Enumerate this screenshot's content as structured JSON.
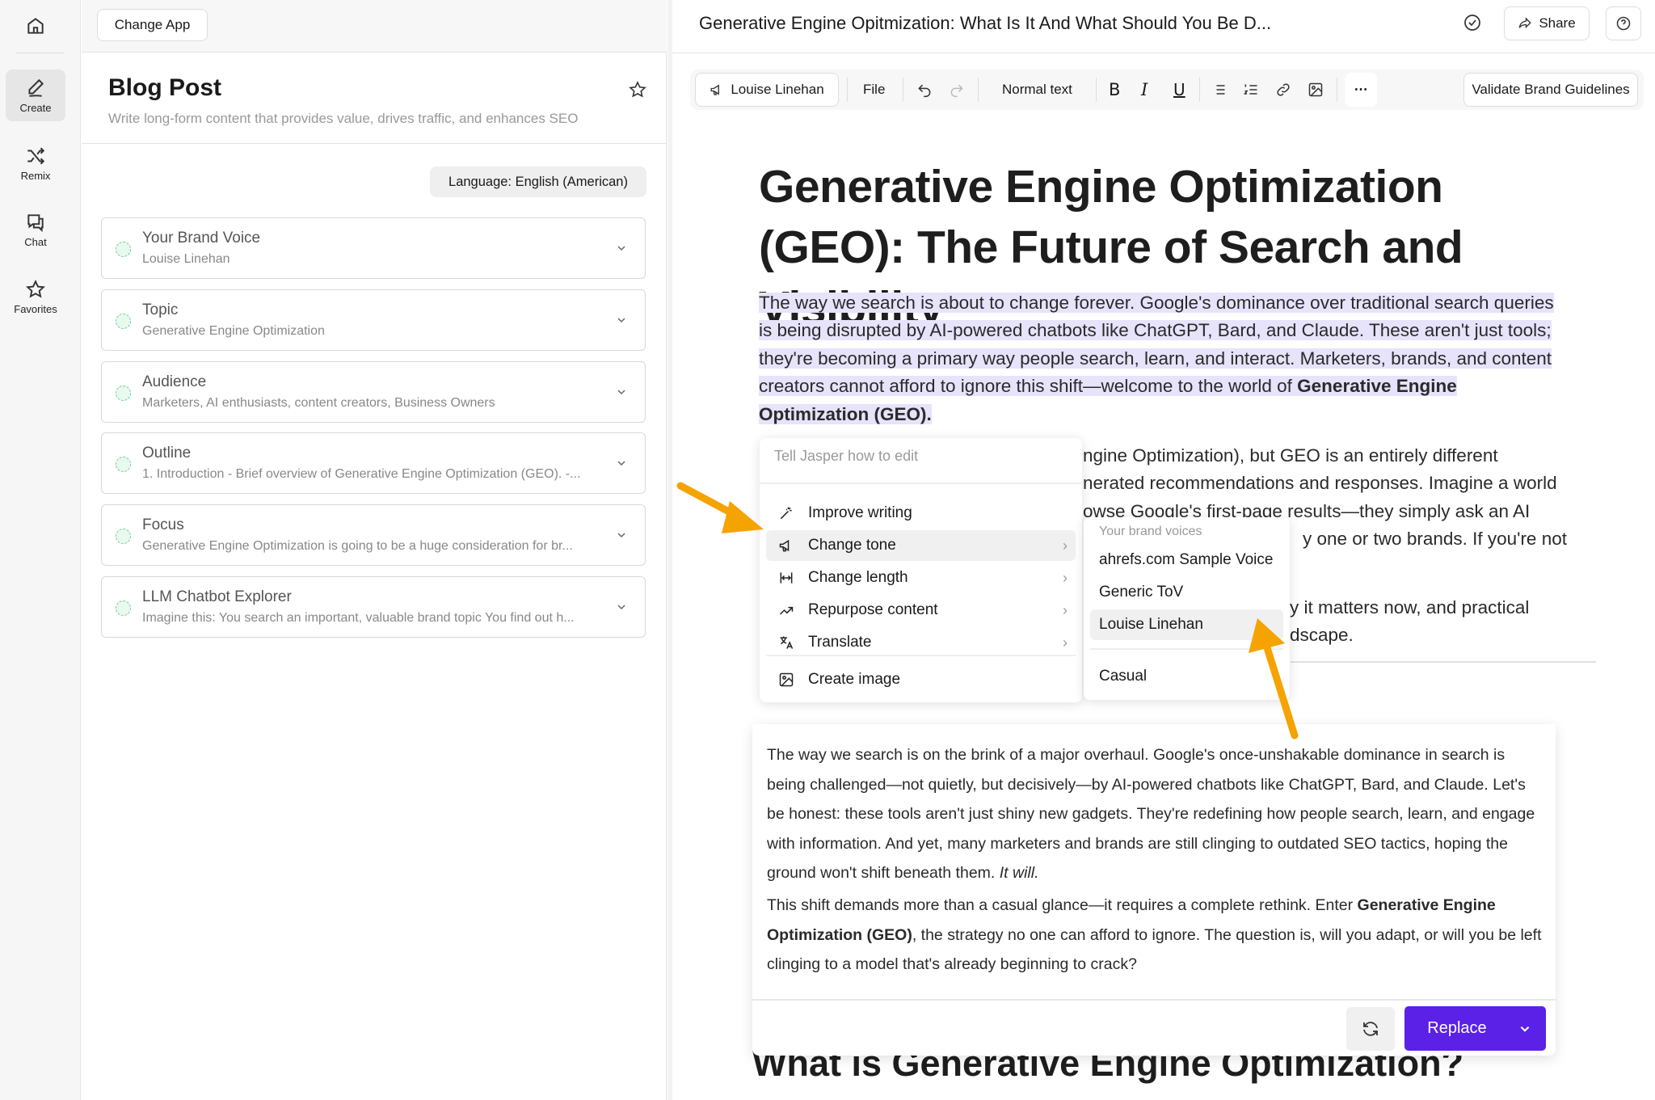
{
  "rail": {
    "items": [
      {
        "label": "",
        "icon": "home-icon"
      },
      {
        "label": "Create",
        "icon": "pen-icon",
        "active": true
      },
      {
        "label": "Remix",
        "icon": "shuffle-icon"
      },
      {
        "label": "Chat",
        "icon": "chat-icon"
      },
      {
        "label": "Favorites",
        "icon": "star-icon"
      }
    ]
  },
  "left": {
    "change_app": "Change App",
    "title": "Blog Post",
    "subtitle": "Write long-form content that provides value, drives traffic, and enhances SEO",
    "language": "Language: English (American)",
    "cards": [
      {
        "title": "Your Brand Voice",
        "value": "Louise Linehan"
      },
      {
        "title": "Topic",
        "value": "Generative Engine Optimization"
      },
      {
        "title": "Audience",
        "value": "Marketers, AI enthusiasts, content creators, Business Owners"
      },
      {
        "title": "Outline",
        "value": "1. Introduction - Brief overview of Generative Engine Optimization (GEO). -..."
      },
      {
        "title": "Focus",
        "value": "Generative Engine Optimization is going to be a huge consideration for br..."
      },
      {
        "title": "LLM Chatbot Explorer",
        "value": "Imagine this: You search an important, valuable brand topic You find out h..."
      }
    ]
  },
  "header": {
    "doc_title": "Generative Engine Opitmization:  What Is It And What Should You Be D...",
    "share": "Share"
  },
  "toolbar": {
    "voice": "Louise Linehan",
    "file": "File",
    "text_style": "Normal text",
    "validate": "Validate Brand Guidelines"
  },
  "doc": {
    "h1": "Generative Engine Optimization (GEO): The Future of Search and Visibility",
    "p1": "The way we search is about to change forever. Google's dominance over traditional search queries is being disrupted by AI-powered chatbots like ChatGPT, Bard, and Claude. These aren't just tools; they're becoming a primary way people search, learn, and interact. Marketers, brands, and content creators cannot afford to ignore this shift—welcome to the world of ",
    "p1_bold": "Generative Engine Optimization (GEO).",
    "p2_lines": [
      "ngine Optimization), but GEO is an entirely different",
      "nerated recommendations and responses. Imagine a world",
      "owse Google's first-page results—they simply ask an AI",
      "y one or two brands. If you're not"
    ],
    "p3_lines": [
      "y it matters now, and practical",
      "dscape."
    ],
    "h2": "What is Generative Engine Optimization?"
  },
  "menu": {
    "placeholder": "Tell Jasper how to edit",
    "items": [
      {
        "label": "Improve writing",
        "icon": "magic-wand-icon"
      },
      {
        "label": "Change tone",
        "icon": "megaphone-icon",
        "selected": true
      },
      {
        "label": "Change length",
        "icon": "length-icon"
      },
      {
        "label": "Repurpose content",
        "icon": "trend-icon"
      },
      {
        "label": "Translate",
        "icon": "translate-icon"
      },
      {
        "label": "Create image",
        "icon": "image-icon"
      }
    ]
  },
  "submenu": {
    "header": "Your brand voices",
    "items": [
      "ahrefs.com Sample Voice",
      "Generic ToV",
      "Louise Linehan",
      "Casual"
    ],
    "selected": "Louise Linehan"
  },
  "result": {
    "p1": "The way we search is on the brink of a major overhaul. Google's once-unshakable dominance in search is being challenged—not quietly, but decisively—by AI-powered chatbots like ChatGPT, Bard, and Claude. Let's be honest: these tools aren't just shiny new gadgets. They're redefining how people search, learn, and engage with information. And yet, many marketers and brands are still clinging to outdated SEO tactics, hoping the ground won't shift beneath them. ",
    "p1_italic": "It will.",
    "p2_a": "This shift demands more than a casual glance—it requires a complete rethink. Enter ",
    "p2_bold": "Generative Engine Optimization (GEO)",
    "p2_b": ", the strategy no one can afford to ignore. The question is, will you adapt, or will you be left clinging to a model that's already beginning to crack?",
    "replace": "Replace"
  },
  "colors": {
    "accent": "#5b21e6",
    "highlight": "#e6e3fb",
    "arrow": "#f5a300"
  }
}
